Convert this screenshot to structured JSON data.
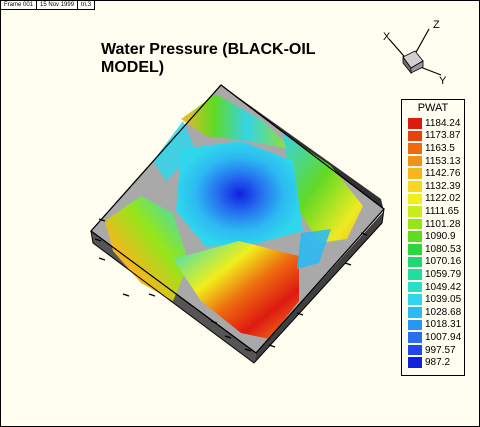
{
  "header": {
    "frame": "Frame 001",
    "date": "15 Nov 1999",
    "version": "tri.3"
  },
  "title": "Water Pressure (BLACK-OIL MODEL)",
  "axis_labels": {
    "x": "X",
    "y": "Y",
    "z": "Z"
  },
  "legend": {
    "title": "PWAT",
    "items": [
      {
        "label": "1184.24",
        "color": "#dd1a10"
      },
      {
        "label": "1173.87",
        "color": "#e8420c"
      },
      {
        "label": "1163.5",
        "color": "#ee6a10"
      },
      {
        "label": "1153.13",
        "color": "#f3901a"
      },
      {
        "label": "1142.76",
        "color": "#f7b51e"
      },
      {
        "label": "1132.39",
        "color": "#f8d81e"
      },
      {
        "label": "1122.02",
        "color": "#f0ee1c"
      },
      {
        "label": "1111.65",
        "color": "#c8ee1a"
      },
      {
        "label": "1101.28",
        "color": "#94e61a"
      },
      {
        "label": "1090.9",
        "color": "#5edc1e"
      },
      {
        "label": "1080.53",
        "color": "#2cd640"
      },
      {
        "label": "1070.16",
        "color": "#20d872"
      },
      {
        "label": "1059.79",
        "color": "#22dca0"
      },
      {
        "label": "1049.42",
        "color": "#28dec8"
      },
      {
        "label": "1039.05",
        "color": "#30d6ec"
      },
      {
        "label": "1028.68",
        "color": "#2cbaf2"
      },
      {
        "label": "1018.31",
        "color": "#2a96f2"
      },
      {
        "label": "1007.94",
        "color": "#2670f0"
      },
      {
        "label": "997.57",
        "color": "#1e48ee"
      },
      {
        "label": "987.2",
        "color": "#1020e0"
      }
    ]
  }
}
